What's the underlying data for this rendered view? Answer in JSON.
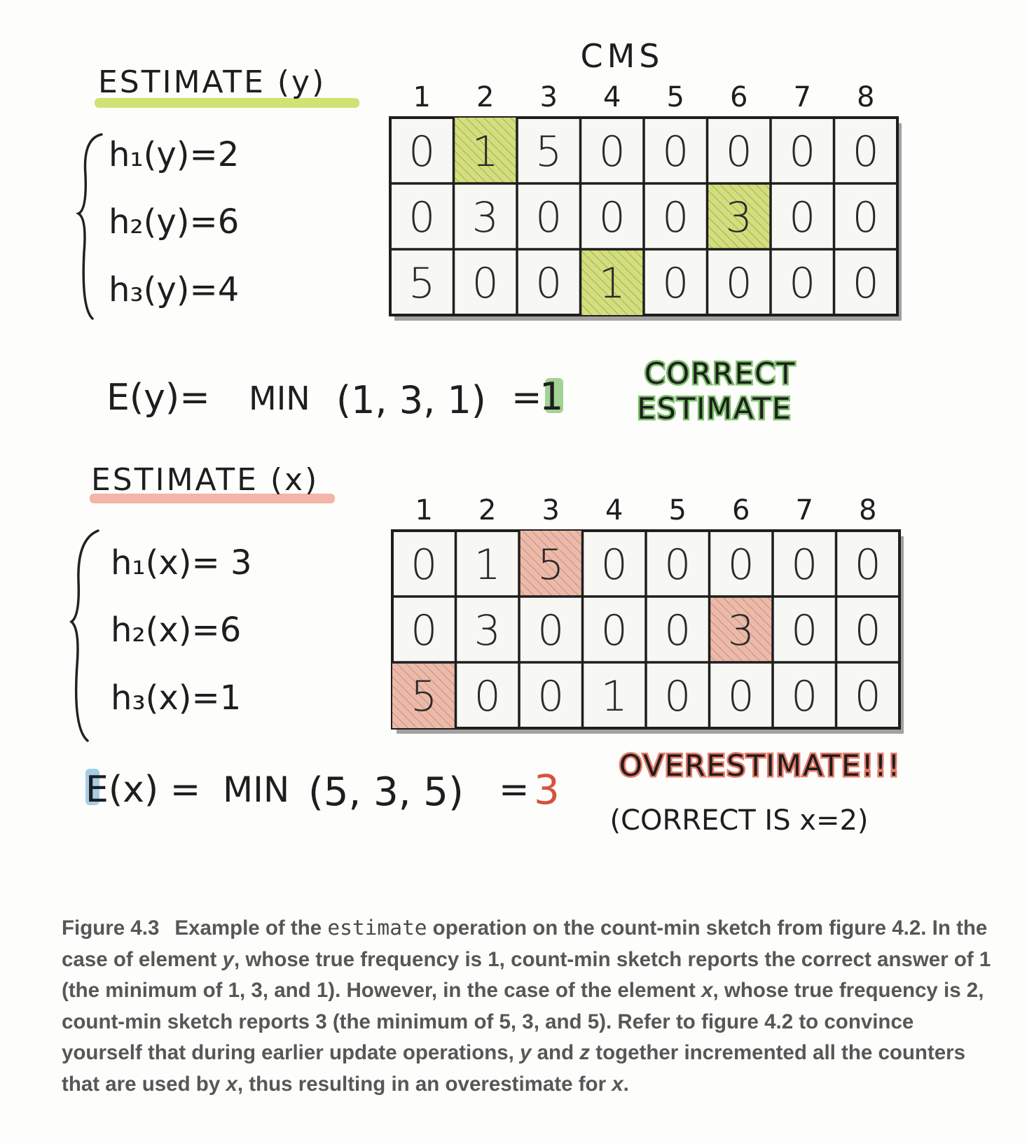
{
  "cms_title": "CMS",
  "column_labels": [
    "1",
    "2",
    "3",
    "4",
    "5",
    "6",
    "7",
    "8"
  ],
  "colors": {
    "y_highlight": "#d3df7a",
    "x_highlight": "#efb9a8",
    "y_underline": "#c9dc5a",
    "x_underline": "#f0a898",
    "correct_green": "#7bbf6a",
    "over_red": "#e57a6a",
    "blue_accent": "#7fb9dd",
    "grid_shadow": "#555555"
  },
  "estimate_y": {
    "heading": "ESTIMATE (y)",
    "hashes": [
      "h₁(y)=2",
      "h₂(y)=6",
      "h₃(y)=4"
    ],
    "grid": [
      [
        "0",
        "1",
        "5",
        "0",
        "0",
        "0",
        "0",
        "0"
      ],
      [
        "0",
        "3",
        "0",
        "0",
        "0",
        "3",
        "0",
        "0"
      ],
      [
        "5",
        "0",
        "0",
        "1",
        "0",
        "0",
        "0",
        "0"
      ]
    ],
    "highlighted_cells": [
      [
        0,
        1
      ],
      [
        1,
        5
      ],
      [
        2,
        3
      ]
    ],
    "formula_lhs": "E(y)=",
    "formula_min": "MIN",
    "formula_args": "(1, 3, 1)",
    "formula_eq": "=",
    "formula_result": "1",
    "note_line1": "CORRECT",
    "note_line2": "ESTIMATE"
  },
  "estimate_x": {
    "heading": "ESTIMATE (x)",
    "hashes": [
      "h₁(x)= 3",
      "h₂(x)=6",
      "h₃(x)=1"
    ],
    "grid": [
      [
        "0",
        "1",
        "5",
        "0",
        "0",
        "0",
        "0",
        "0"
      ],
      [
        "0",
        "3",
        "0",
        "0",
        "0",
        "3",
        "0",
        "0"
      ],
      [
        "5",
        "0",
        "0",
        "1",
        "0",
        "0",
        "0",
        "0"
      ]
    ],
    "highlighted_cells": [
      [
        0,
        2
      ],
      [
        1,
        5
      ],
      [
        2,
        0
      ]
    ],
    "formula_lhs": "E(x) =",
    "formula_min": "MIN",
    "formula_args": "(5, 3, 5)",
    "formula_eq": "=",
    "formula_result": "3",
    "note_line1": "OVERESTIMATE!!!",
    "note_line2": "(CORRECT IS  x=2)"
  },
  "caption": {
    "label": "Figure 4.3",
    "t1": "Example of the ",
    "code": "estimate",
    "t2": " operation on the count-min sketch from figure 4.2. In the case of element ",
    "y1": "y",
    "t3": ", whose true frequency is 1, count-min sketch reports the correct answer of 1 (the minimum of 1, 3, and 1). However, in the case of the element ",
    "x1": "x",
    "t4": ", whose true frequency is 2, count-min sketch reports 3 (the minimum of 5, 3, and 5). Refer to figure 4.2 to convince yourself that during earlier update operations, ",
    "y2": "y",
    "t5": " and ",
    "z1": "z",
    "t6": " together incremented all the counters that are used by ",
    "x2": "x",
    "t7": ", thus resulting in an overestimate for ",
    "x3": "x",
    "t8": "."
  }
}
